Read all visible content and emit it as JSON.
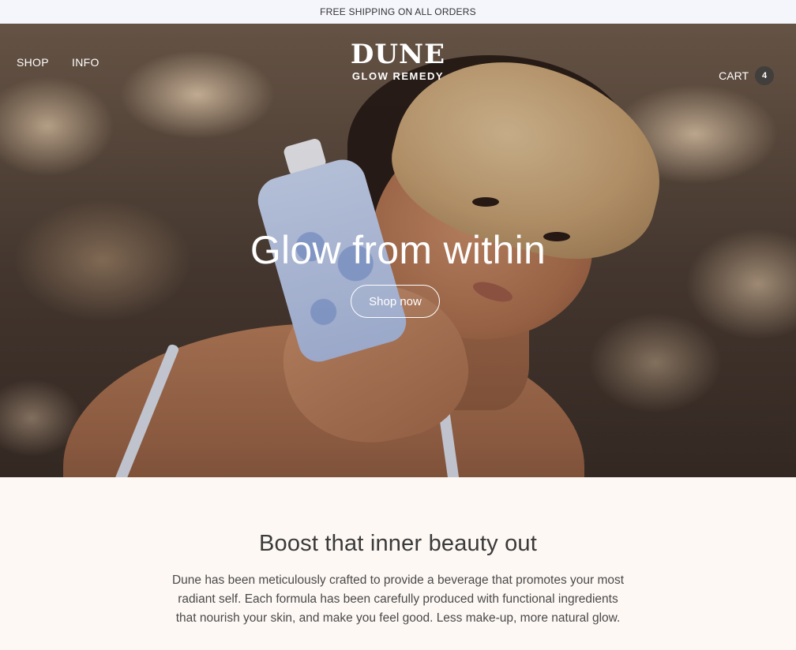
{
  "announcement": {
    "text": "FREE SHIPPING ON ALL ORDERS"
  },
  "header": {
    "nav": [
      {
        "label": "SHOP"
      },
      {
        "label": "INFO"
      }
    ],
    "logo": {
      "main": "DUNE",
      "sub": "GLOW REMEDY"
    },
    "cart": {
      "label": "CART",
      "count": "4"
    }
  },
  "hero": {
    "title": "Glow from within",
    "cta_label": "Shop now"
  },
  "intro": {
    "title": "Boost that inner beauty out",
    "body": "Dune has been meticulously crafted to provide a beverage that promotes your most radiant self. Each formula has been carefully produced with functional ingredients that nourish your skin, and make you feel good. Less make-up, more natural glow."
  }
}
